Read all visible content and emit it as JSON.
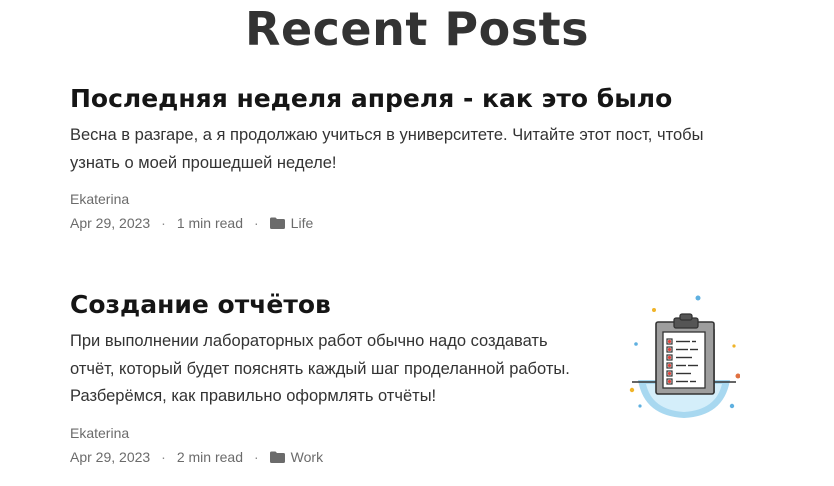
{
  "page": {
    "title": "Recent Posts"
  },
  "posts": [
    {
      "title": "Последняя неделя апреля - как это было",
      "excerpt": "Весна в разгаре, а я продолжаю учиться в университете. Читайте этот пост, чтобы узнать о моей прошедшей неделе!",
      "author": "Ekaterina",
      "date": "Apr 29, 2023",
      "read_time": "1 min read",
      "category": "Life",
      "category_icon": "folder-icon"
    },
    {
      "title": "Создание отчётов",
      "excerpt": "При выполнении лабораторных работ обычно надо создавать отчёт, который будет пояснять каждый шаг проделанной работы. Разберёмся, как правильно оформлять отчёты!",
      "author": "Ekaterina",
      "date": "Apr 29, 2023",
      "read_time": "2 min read",
      "category": "Work",
      "category_icon": "folder-icon",
      "thumbnail_icon": "clipboard-checklist-icon"
    }
  ],
  "meta_separator": "·",
  "colors": {
    "title": "#151515",
    "meta": "#6b6b6b",
    "accent_blue": "#a8d8f0"
  }
}
